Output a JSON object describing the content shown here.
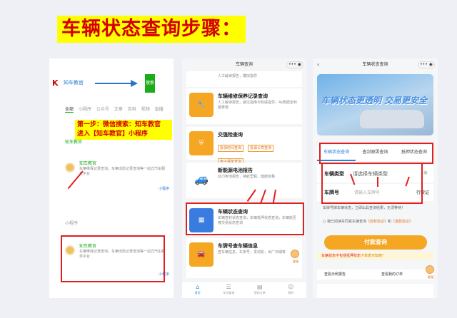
{
  "title": "车辆状态查询步骤：",
  "phone1": {
    "logo": "K",
    "search_query": "知车教官",
    "go_label": "搜索",
    "tabs": [
      "全部",
      "小程序",
      "公众号",
      "文章",
      "百科",
      "视频",
      "直播"
    ],
    "note_line1": "第一步：微信搜索：知车教官",
    "note_line2": "进入【知车教官】小程序",
    "result1_label": "知车教官",
    "result1": {
      "name": "知车教官",
      "desc": "车辆维保记录查询，车辆出险记录查询等一站式汽车服务平台",
      "tag": "小程序"
    },
    "section_label": "小程序",
    "result2": {
      "name": "知车教官",
      "desc": "车辆维保记录查询，车辆出险记录查询等一站式汽车服务平台",
      "tag": "小程序"
    }
  },
  "phone2": {
    "header": "车辆查询",
    "items": [
      {
        "title": "",
        "desc": "人工解读报告，模拟指导"
      },
      {
        "title": "车辆维修保养记录查询",
        "desc": "人工解读报告，避坑指南与权威指导，4s数据全到最靠谱"
      },
      {
        "title": "交强险查询",
        "insurance": [
          "投保时间查询",
          "投保公司查询",
          "电子保单查询"
        ]
      },
      {
        "title": "新能源电池报告",
        "desc": "动力电池报告，续航里程，健康容量"
      },
      {
        "title": "车辆状态查询",
        "desc": "车辆查封状态查询，车辆抵押状态查询，车辆能否被交易状态查询"
      },
      {
        "title": "车牌号查车辆信息",
        "desc": "查车辆信息，车架号，发动机，出厂日期等"
      }
    ],
    "tabbar": [
      "首页",
      "车况查询",
      "我的订单",
      "我的"
    ],
    "tab_icons": [
      "⌂",
      "☰",
      "▤",
      "☺"
    ],
    "mascot_label": "客服"
  },
  "phone3": {
    "header": "车辆状态查询",
    "banner_text": "车辆状态更透明 交易更安全",
    "tabs": [
      "车辆状态查询",
      "查封原因查询",
      "抵押状态查询"
    ],
    "vehicle_type_label": "车辆类型",
    "vehicle_type_value": "请选择车辆类型",
    "plate_label": "车牌号",
    "plate_placeholder": "请输入车牌号",
    "scan_label": "行驶证",
    "info": "车牌号牌车辆状态，立即出具查询结果，无须等待！",
    "agree_text": "我已阅读并同意车辆查询",
    "agree_link1": "《授权协议》",
    "agree_and": "和",
    "agree_link2": "《退款协议》",
    "pay_label": "付款查询",
    "warn_pre": "",
    "warn_red": "车辆状态不包括抵押状态",
    "warn_post": "下单表示知晓!",
    "link1": "查看示例报告",
    "link2": "查看我的订单",
    "mascot_label": "客服"
  },
  "colors": {
    "accent_red": "#e02020",
    "title_yellow": "#ffff00",
    "wechat_green": "#1aad19",
    "orange": "#f5a623"
  }
}
